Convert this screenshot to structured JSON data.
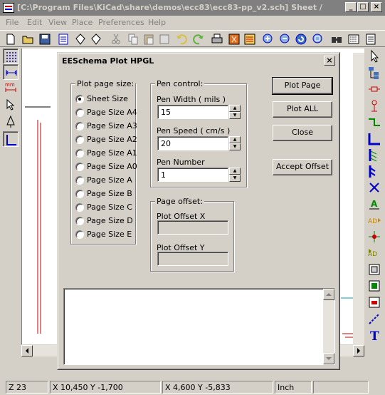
{
  "window": {
    "title": "[C:\\Program Files\\KiCad\\share\\demos\\ecc83\\ecc83-pp_v2.sch]  Sheet /",
    "min_label": "_",
    "max_label": "□",
    "close_label": "×"
  },
  "menu": [
    "File",
    "Edit",
    "View",
    "Place",
    "Preferences",
    "Help"
  ],
  "dialog": {
    "title": "EESchema Plot HPGL",
    "close_label": "×",
    "page_size": {
      "legend": "Plot page size:",
      "options": [
        "Sheet Size",
        "Page Size A4",
        "Page Size A3",
        "Page Size A2",
        "Page Size A1",
        "Page Size A0",
        "Page Size A",
        "Page Size B",
        "Page Size C",
        "Page Size D",
        "Page Size E"
      ],
      "selected": "Sheet Size"
    },
    "pen_control": {
      "legend": "Pen control:",
      "pen_width_label": "Pen Width ( mils )",
      "pen_width_value": "15",
      "pen_speed_label": "Pen Speed ( cm/s )",
      "pen_speed_value": "20",
      "pen_number_label": "Pen Number",
      "pen_number_value": "1"
    },
    "page_offset": {
      "legend": "Page offset:",
      "offset_x_label": "Plot Offset X",
      "offset_x_value": "",
      "offset_y_label": "Plot Offset Y",
      "offset_y_value": ""
    },
    "buttons": {
      "plot_page": "Plot Page",
      "plot_all": "Plot ALL",
      "close": "Close",
      "accept_offset": "Accept Offset"
    }
  },
  "status": {
    "zoom": "Z 23",
    "abs_coords": "X 10,450  Y -1,700",
    "rel_coords": "X 4,600  Y -5,833",
    "units": "Inch"
  },
  "colors": {
    "schematic_wire": "#c00000",
    "accent_blue": "#0000c0"
  }
}
